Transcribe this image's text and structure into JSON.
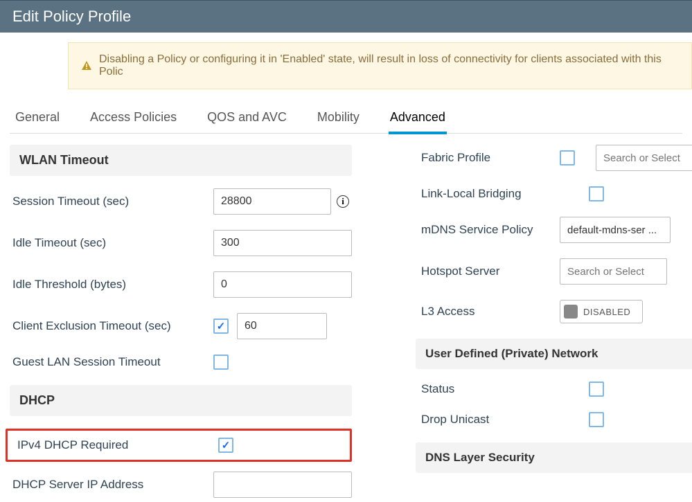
{
  "header": {
    "title": "Edit Policy Profile"
  },
  "alert": {
    "text": "Disabling a Policy or configuring it in 'Enabled' state, will result in loss of connectivity for clients associated with this Polic"
  },
  "tabs": {
    "general": "General",
    "access": "Access Policies",
    "qos": "QOS and AVC",
    "mobility": "Mobility",
    "advanced": "Advanced"
  },
  "left": {
    "section_wlan": "WLAN Timeout",
    "session_timeout_label": "Session Timeout (sec)",
    "session_timeout_value": "28800",
    "idle_timeout_label": "Idle Timeout (sec)",
    "idle_timeout_value": "300",
    "idle_threshold_label": "Idle Threshold (bytes)",
    "idle_threshold_value": "0",
    "client_excl_label": "Client Exclusion Timeout (sec)",
    "client_excl_value": "60",
    "guest_lan_label": "Guest LAN Session Timeout",
    "section_dhcp": "DHCP",
    "ipv4_dhcp_label": "IPv4 DHCP Required",
    "dhcp_server_label": "DHCP Server IP Address",
    "dhcp_server_value": ""
  },
  "right": {
    "fabric_label": "Fabric Profile",
    "fabric_placeholder": "Search or Select",
    "link_local_label": "Link-Local Bridging",
    "mdns_label": "mDNS Service Policy",
    "mdns_value": "default-mdns-ser ...",
    "hotspot_label": "Hotspot Server",
    "hotspot_placeholder": "Search or Select",
    "l3_label": "L3 Access",
    "l3_state": "DISABLED",
    "section_udn": "User Defined (Private) Network",
    "status_label": "Status",
    "drop_unicast_label": "Drop Unicast",
    "section_dns": "DNS Layer Security"
  },
  "info_icon_char": "i"
}
